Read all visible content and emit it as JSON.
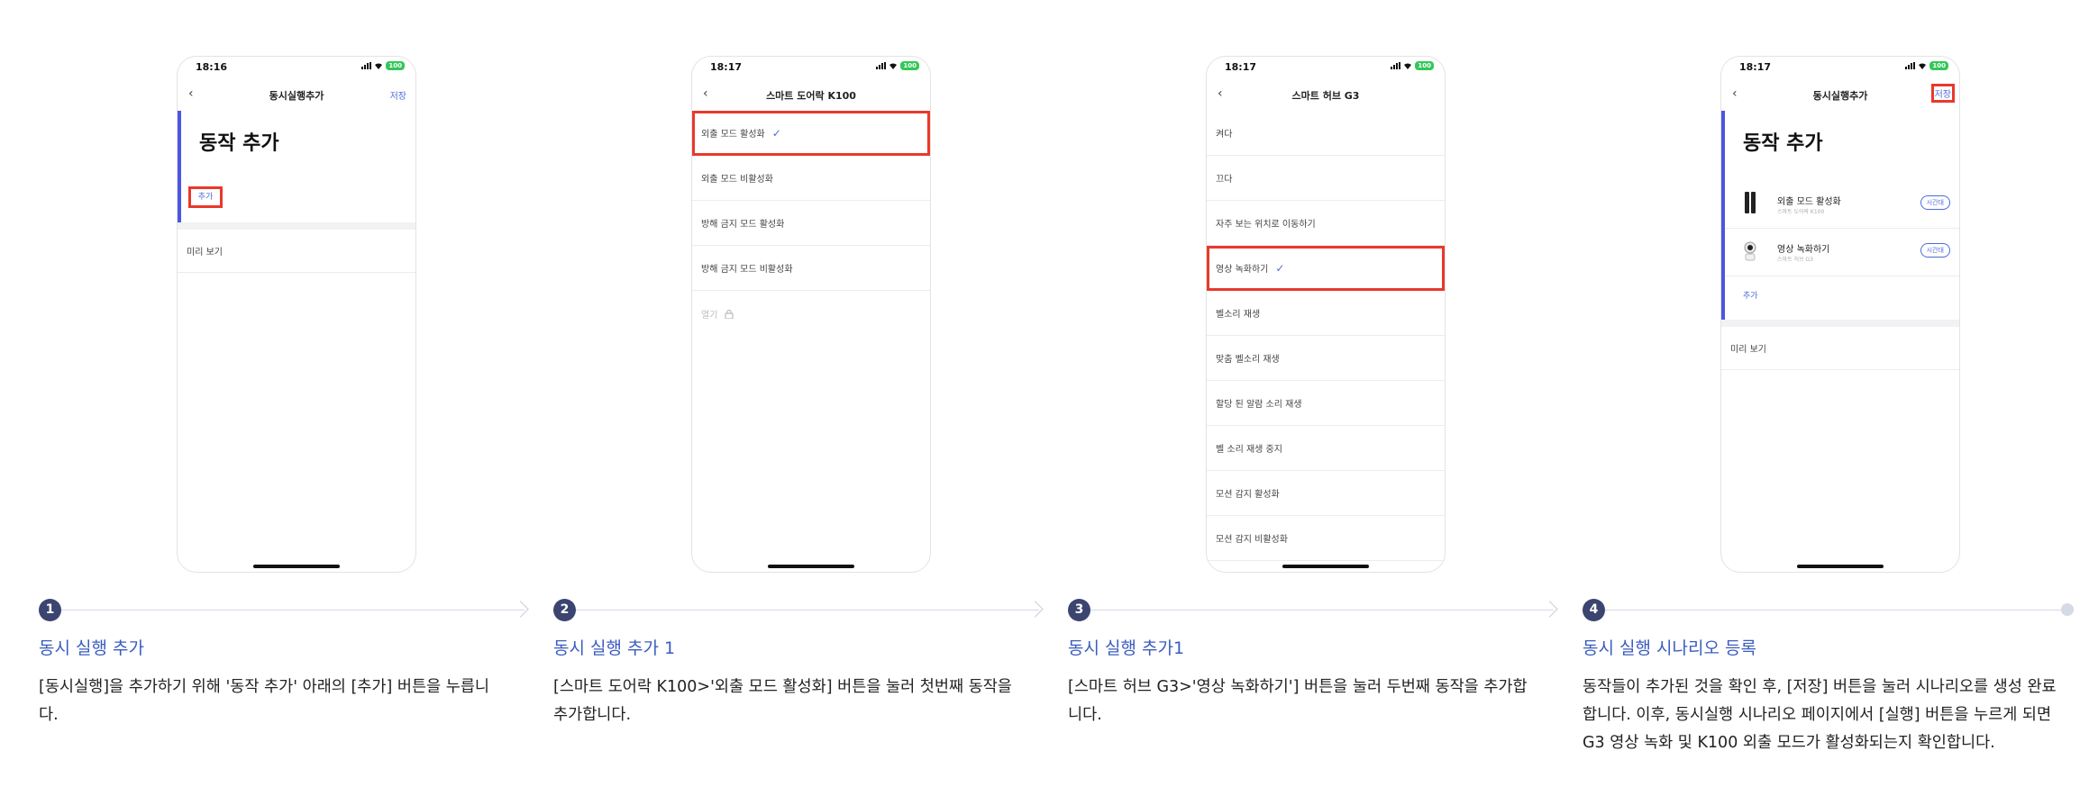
{
  "screens": {
    "s1": {
      "time": "18:16",
      "battery": "100",
      "nav_title": "동시실행추가",
      "save_label": "저장",
      "section_title": "동작 추가",
      "add_label": "추가",
      "preview_label": "미리 보기"
    },
    "s2": {
      "time": "18:17",
      "battery": "100",
      "nav_title": "스마트 도어락 K100",
      "items": [
        "외출 모드 활성화",
        "외출 모드 비활성화",
        "방해 금지 모드 활성화",
        "방해 금지 모드 비활성화",
        "열기"
      ]
    },
    "s3": {
      "time": "18:17",
      "battery": "100",
      "nav_title": "스마트 허브 G3",
      "items": [
        "켜다",
        "끄다",
        "자주 보는 위치로 이동하기",
        "영상 녹화하기",
        "벨소리 재생",
        "맞춤 벨소리 재생",
        "할당 된 알람 소리 재생",
        "벨 소리 재생 중지",
        "모션 감지 활성화",
        "모션 감지 비활성화"
      ]
    },
    "s4": {
      "time": "18:17",
      "battery": "100",
      "nav_title": "동시실행추가",
      "save_label": "저장",
      "section_title": "동작 추가",
      "actions": [
        {
          "name": "외출 모드 활성화",
          "device": "스마트 도어락 K100",
          "pill": "시간대"
        },
        {
          "name": "영상 녹화하기",
          "device": "스마트 허브 G3",
          "pill": "시간대"
        }
      ],
      "add_label": "추가",
      "preview_label": "미리 보기"
    }
  },
  "steps": [
    {
      "num": "1",
      "title": "동시 실행 추가",
      "desc": "[동시실행]을 추가하기 위해 '동작 추가' 아래의 [추가] 버튼을 누릅니다."
    },
    {
      "num": "2",
      "title": "동시 실행 추가 1",
      "desc": "[스마트 도어락 K100>'외출 모드 활성화] 버튼을 눌러 첫번째 동작을 추가합니다."
    },
    {
      "num": "3",
      "title": "동시 실행 추가1",
      "desc": "[스마트 허브 G3>'영상 녹화하기'] 버튼을 눌러 두번째 동작을 추가합니다."
    },
    {
      "num": "4",
      "title": "동시 실행 시나리오 등록",
      "desc": "동작들이 추가된 것을 확인 후, [저장] 버튼을 눌러 시나리오를 생성 완료 합니다. 이후, 동시실행 시나리오 페이지에서 [실행] 버튼을 누르게 되면 G3 영상 녹화 및 K100 외출 모드가 활성화되는지 확인합니다."
    }
  ],
  "colors": {
    "accent": "#4b56e3",
    "highlight": "#e8392b",
    "step_title": "#3b5cc0",
    "step_circle": "#3c4470"
  },
  "icons": {
    "back": "chevron-left-icon",
    "check": "check-icon",
    "lock": "lock-icon"
  }
}
